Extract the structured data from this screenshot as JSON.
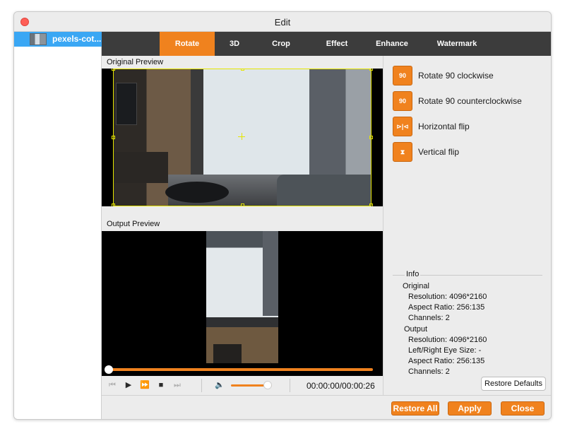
{
  "window": {
    "title": "Edit"
  },
  "file_list": {
    "items": [
      {
        "name": "pexels-cot..."
      }
    ]
  },
  "tabs": [
    {
      "label": "Rotate",
      "active": true
    },
    {
      "label": "3D"
    },
    {
      "label": "Crop"
    },
    {
      "label": "Effect"
    },
    {
      "label": "Enhance"
    },
    {
      "label": "Watermark"
    }
  ],
  "preview": {
    "original_label": "Original Preview",
    "output_label": "Output Preview"
  },
  "player": {
    "timecode": "00:00:00/00:00:26",
    "seek_progress": 0.0,
    "volume_level": 0.9
  },
  "actions": [
    {
      "label": "Rotate 90 clockwise",
      "icon": "rotate-cw-icon",
      "glyph": "90"
    },
    {
      "label": "Rotate 90 counterclockwise",
      "icon": "rotate-ccw-icon",
      "glyph": "90"
    },
    {
      "label": "Horizontal flip",
      "icon": "flip-horizontal-icon",
      "glyph": "⊳|⊲"
    },
    {
      "label": "Vertical flip",
      "icon": "flip-vertical-icon",
      "glyph": "⧗"
    }
  ],
  "info": {
    "title": "Info",
    "original": {
      "heading": "Original",
      "resolution": "Resolution: 4096*2160",
      "aspect_ratio": "Aspect Ratio: 256:135",
      "channels": "Channels: 2"
    },
    "output": {
      "heading": "Output",
      "resolution": "Resolution: 4096*2160",
      "eye_size": "Left/Right Eye Size: -",
      "aspect_ratio": "Aspect Ratio: 256:135",
      "channels": "Channels: 2"
    },
    "restore_defaults_label": "Restore Defaults"
  },
  "footer": {
    "restore_all_label": "Restore All",
    "apply_label": "Apply",
    "close_label": "Close"
  },
  "colors": {
    "accent": "#f0821e",
    "tabbar": "#3c3c3c",
    "selection": "#3aa7f4"
  }
}
